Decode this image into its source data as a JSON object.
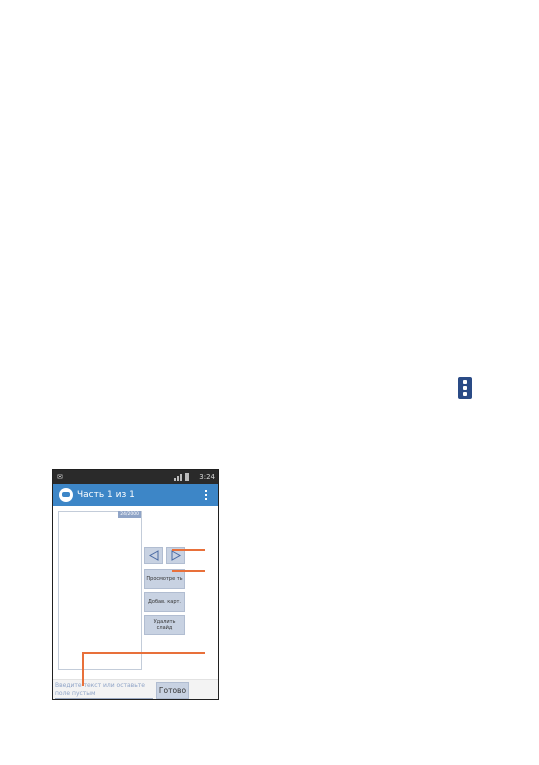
{
  "status_bar": {
    "left_text": "✉",
    "time": "3:24"
  },
  "action_bar": {
    "title": "Часть 1 из 1"
  },
  "slide": {
    "counter": "24/2000"
  },
  "buttons": {
    "prev": "◁",
    "next": "▷",
    "preview": "Просмотре ть",
    "add_picture": "Добав. карт.",
    "delete_slide": "Удалить слайд",
    "done": "Готово"
  },
  "compose": {
    "placeholder": "Введите текст или оставьте поле пустым"
  },
  "icons": {
    "overflow_menu": "overflow-menu-icon",
    "app": "message-icon",
    "prev": "triangle-left-icon",
    "next": "triangle-right-icon"
  },
  "colors": {
    "action_bar": "#3d86c7",
    "callout": "#e8703a",
    "button": "#c8d2e2",
    "menu_icon": "#2a4b86"
  }
}
